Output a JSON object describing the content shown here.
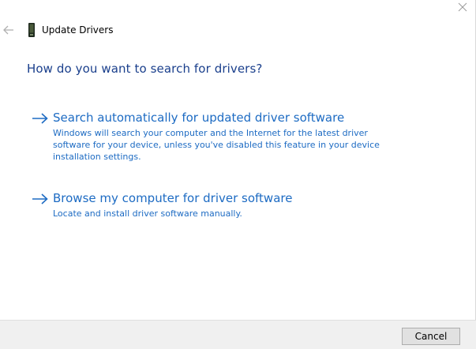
{
  "window": {
    "title": "Update Drivers"
  },
  "heading": "How do you want to search for drivers?",
  "options": [
    {
      "title": "Search automatically for updated driver software",
      "description": "Windows will search your computer and the Internet for the latest driver software for your device, unless you've disabled this feature in your device installation settings."
    },
    {
      "title": "Browse my computer for driver software",
      "description": "Locate and install driver software manually."
    }
  ],
  "footer": {
    "cancel_label": "Cancel"
  },
  "icons": {
    "close": "close-icon",
    "back": "back-arrow-icon",
    "app": "device-icon",
    "option_arrow": "arrow-right-icon"
  },
  "colors": {
    "heading": "#1a3f8c",
    "link": "#1d6bc3",
    "footer_bg": "#f0f0f0"
  }
}
